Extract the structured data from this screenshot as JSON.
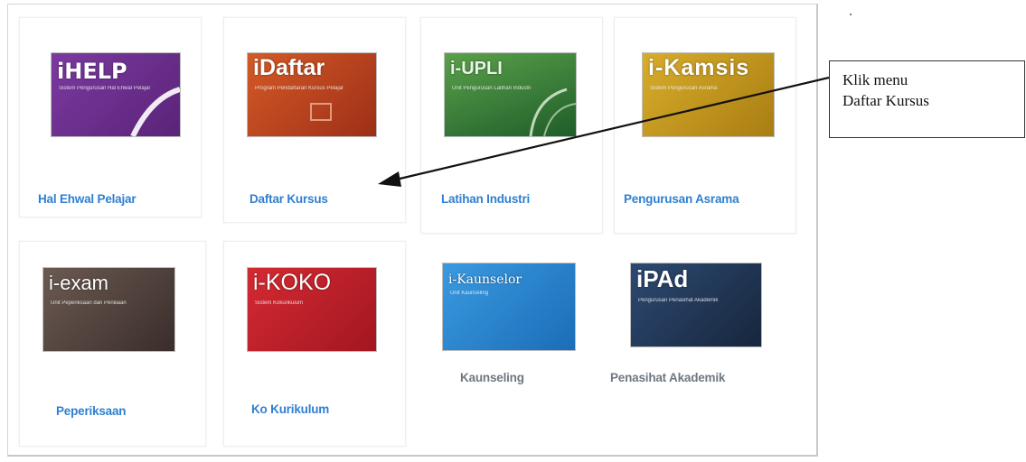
{
  "tiles": [
    {
      "banner_title": "iHELP",
      "banner_subtitle": "Sistem Pengurusan Hal Ehwal Pelajar",
      "label": "Hal Ehwal Pelajar",
      "color": "#6a2a8c"
    },
    {
      "banner_title": "iDaftar",
      "banner_subtitle": "Program Pendaftaran Kursus Pelajar",
      "label": "Daftar Kursus",
      "color": "#c24a22"
    },
    {
      "banner_title": "i-UPLI",
      "banner_subtitle": "Unit Pengurusan Latihan Industri",
      "label": "Latihan Industri",
      "color": "#2c7a34"
    },
    {
      "banner_title": "i-Kamsis",
      "banner_subtitle": "Sistem Pengurusan Asrama",
      "label": "Pengurusan Asrama",
      "color": "#c49a1c"
    },
    {
      "banner_title": "i-exam",
      "banner_subtitle": "Unit Peperiksaan dan Penilaian",
      "label": "Peperiksaan",
      "color": "#4f3f3a"
    },
    {
      "banner_title": "i-KOKO",
      "banner_subtitle": "Sistem Kokurikulum",
      "label": "Ko Kurikulum",
      "color": "#c2202a"
    },
    {
      "banner_title": "i-Kaunselor",
      "banner_subtitle": "Unit Kaunseling",
      "label": "Kaunseling",
      "color": "#2f8ad3"
    },
    {
      "banner_title": "iPAd",
      "banner_subtitle": "Pengurusan Penasihat Akademik",
      "label": "Penasihat Akademik",
      "color": "#1e3654"
    }
  ],
  "callout": {
    "line1": "Klik menu",
    "line2": "Daftar Kursus"
  },
  "colors": {
    "label_blue": "#2f7fd1",
    "label_grey": "#6e7781",
    "arrow": "#111111"
  }
}
